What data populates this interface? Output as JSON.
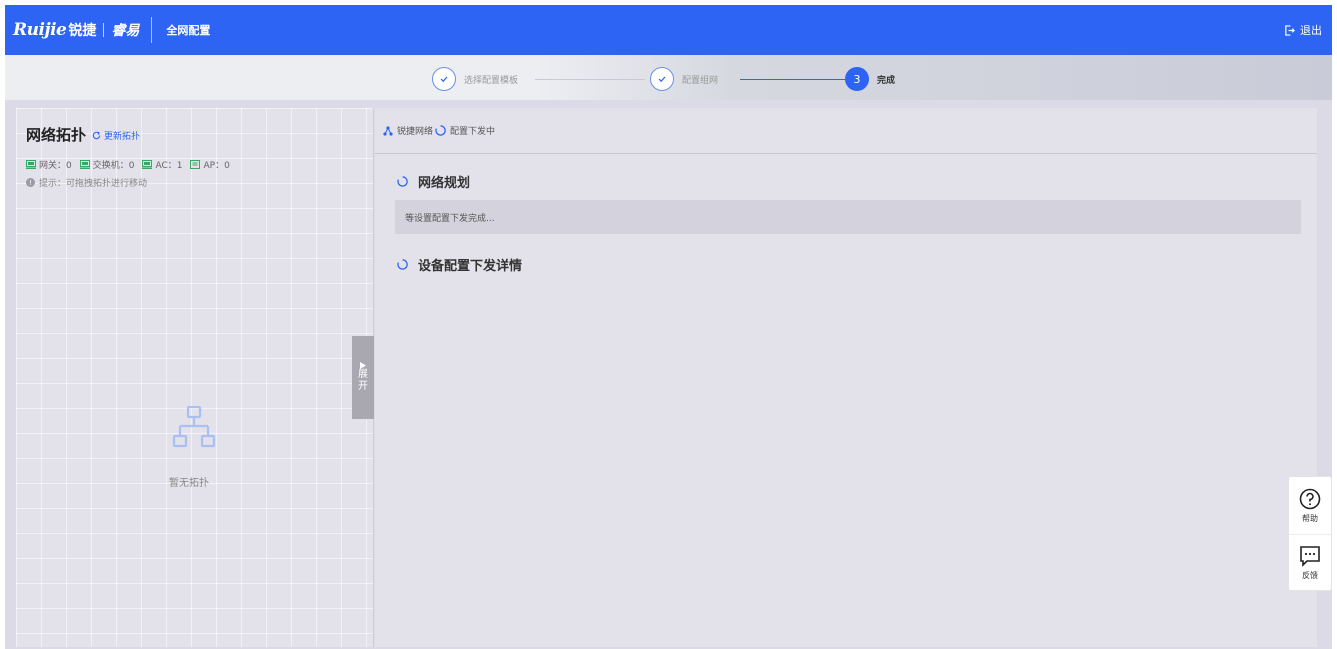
{
  "header": {
    "brand_ruijie": "Ruijie",
    "brand_cn": "锐捷",
    "brand_rj": "睿易",
    "title": "全网配置",
    "logout_label": "退出"
  },
  "steps": [
    {
      "label": "选择配置模板",
      "state": "done"
    },
    {
      "label": "配置组网",
      "state": "done"
    },
    {
      "number": "3",
      "label": "完成",
      "state": "active"
    }
  ],
  "topology": {
    "title": "网络拓扑",
    "refresh_label": "更新拓扑",
    "counts": [
      {
        "label": "网关：0"
      },
      {
        "label": "交换机：0"
      },
      {
        "label": "AC：1"
      },
      {
        "label": "AP：0"
      }
    ],
    "hint": "提示：可拖拽拓扑进行移动",
    "empty_label": "暂无拓扑",
    "expand_chars": [
      "展",
      "开"
    ]
  },
  "deploy": {
    "network_link": "锐捷网络",
    "status": "配置下发中",
    "sections": [
      {
        "title": "网络规划"
      },
      {
        "title": "设备配置下发详情"
      }
    ],
    "message": "等设置配置下发完成..."
  },
  "float": {
    "help": "帮助",
    "feedback": "反馈"
  },
  "colors": {
    "primary": "#2d64f3",
    "content_bg": "#dcdae6",
    "device_green": "#3aa660"
  }
}
